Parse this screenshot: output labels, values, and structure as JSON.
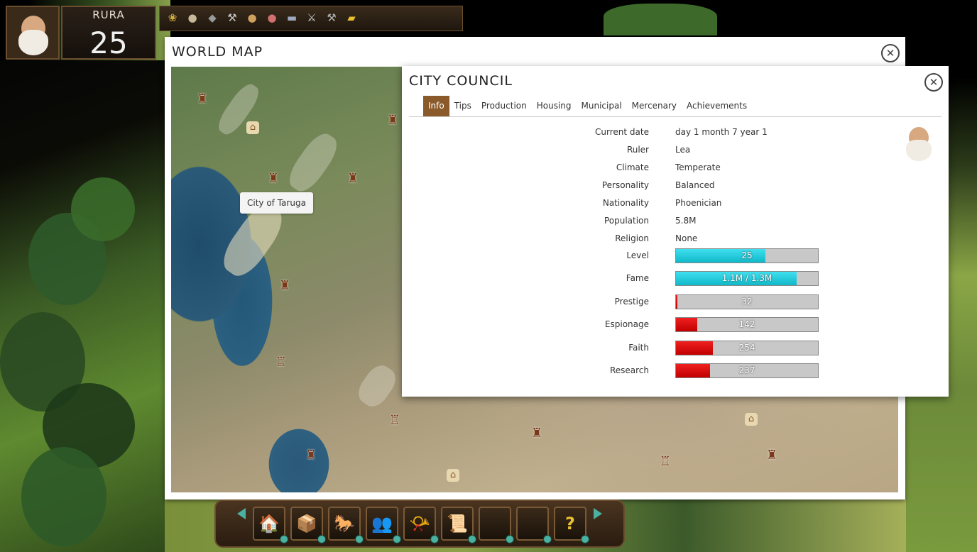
{
  "hud": {
    "player_name": "RURA",
    "level": "25",
    "resources": [
      {
        "icon": "grain-icon",
        "glyph": "❀",
        "color": "#d8b040"
      },
      {
        "icon": "flour-icon",
        "glyph": "●",
        "color": "#c8b89a"
      },
      {
        "icon": "stone-icon",
        "glyph": "◆",
        "color": "#9a9a9a"
      },
      {
        "icon": "tools-icon",
        "glyph": "⚒",
        "color": "#c8c8c8"
      },
      {
        "icon": "bread-icon",
        "glyph": "●",
        "color": "#d0a060"
      },
      {
        "icon": "meat-icon",
        "glyph": "●",
        "color": "#d07070"
      },
      {
        "icon": "cloth-icon",
        "glyph": "▬",
        "color": "#a0a8c0"
      },
      {
        "icon": "weapons-icon",
        "glyph": "⚔",
        "color": "#d0d0d0"
      },
      {
        "icon": "hammer-icon",
        "glyph": "⚒",
        "color": "#b0b0b0"
      },
      {
        "icon": "gold-icon",
        "glyph": "▰",
        "color": "#e8c030"
      }
    ]
  },
  "world_map": {
    "title": "WORLD MAP",
    "tooltip": "City of Taruga"
  },
  "council": {
    "title": "CITY COUNCIL",
    "tabs": [
      "Info",
      "Tips",
      "Production",
      "Housing",
      "Municipal",
      "Mercenary",
      "Achievements"
    ],
    "info": [
      {
        "label": "Current date",
        "value": "day 1 month 7 year 1"
      },
      {
        "label": "Ruler",
        "value": "Lea"
      },
      {
        "label": "Climate",
        "value": "Temperate"
      },
      {
        "label": "Personality",
        "value": "Balanced"
      },
      {
        "label": "Nationality",
        "value": "Phoenician"
      },
      {
        "label": "Population",
        "value": "5.8M"
      },
      {
        "label": "Religion",
        "value": "None"
      }
    ],
    "stats": [
      {
        "label": "Level",
        "text": "25",
        "fill": 0.63,
        "color": "cyan"
      },
      {
        "label": "Fame",
        "text": "1.1M / 1.3M",
        "fill": 0.85,
        "color": "cyan"
      },
      {
        "label": "Prestige",
        "text": "32",
        "fill": 0.01,
        "color": "red"
      },
      {
        "label": "Espionage",
        "text": "142",
        "fill": 0.15,
        "color": "red"
      },
      {
        "label": "Faith",
        "text": "254",
        "fill": 0.26,
        "color": "red"
      },
      {
        "label": "Research",
        "text": "237",
        "fill": 0.24,
        "color": "red"
      }
    ]
  },
  "toolbar": {
    "buttons": [
      {
        "name": "city-button",
        "glyph": "🏠"
      },
      {
        "name": "storage-button",
        "glyph": "📦"
      },
      {
        "name": "trade-button",
        "glyph": "🐎"
      },
      {
        "name": "council-button",
        "glyph": "👥"
      },
      {
        "name": "military-button",
        "glyph": "📯"
      },
      {
        "name": "scrolls-button",
        "glyph": "📜"
      },
      {
        "name": "empty-slot-1-button",
        "glyph": ""
      },
      {
        "name": "empty-slot-2-button",
        "glyph": ""
      },
      {
        "name": "help-button",
        "glyph": "?"
      }
    ]
  }
}
